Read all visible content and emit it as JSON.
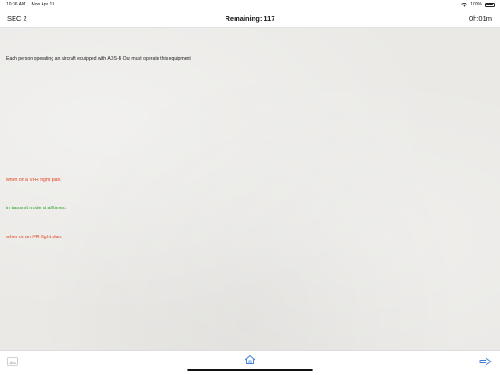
{
  "status_bar": {
    "time": "10:36 AM",
    "date": "Mon Apr 13",
    "battery": "100%",
    "icons": [
      "wifi-icon",
      "battery-icon"
    ]
  },
  "nav_bar": {
    "section": "SEC 2",
    "remaining": "Remaining: 117",
    "timer": "0h:01m"
  },
  "question": {
    "text": "Each person operating an aircraft equipped with ADS-B Out must operate this equipment"
  },
  "answers": [
    {
      "text": "when on a VFR flight plan.",
      "status": "incorrect"
    },
    {
      "text": "in transmit mode at all times.",
      "status": "correct"
    },
    {
      "text": "when on an IFR flight plan.",
      "status": "incorrect"
    }
  ],
  "colors": {
    "incorrect": "#e0401e",
    "correct": "#1e9e1e",
    "toolbar_icon": "#3d7fd9"
  },
  "toolbar": {
    "icons": [
      "image-icon",
      "home-icon",
      "next-arrow-icon"
    ]
  }
}
